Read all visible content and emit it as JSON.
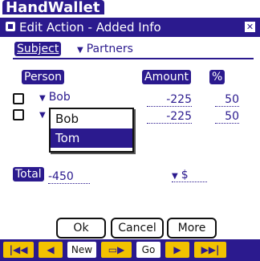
{
  "app": {
    "title": "HandWallet"
  },
  "dialog": {
    "title": "Edit Action - Added Info",
    "close_glyph": "✕"
  },
  "subject": {
    "label": "Subject",
    "value": "Partners"
  },
  "columns": {
    "person": "Person",
    "amount": "Amount",
    "percent": "%"
  },
  "rows": [
    {
      "person": "Bob",
      "amount": "-225",
      "percent": "50"
    },
    {
      "person": "",
      "amount": "-225",
      "percent": "50"
    }
  ],
  "popup": {
    "options": [
      "Bob",
      "Tom"
    ],
    "selected": "Tom"
  },
  "total": {
    "label": "Total",
    "amount": "-450",
    "currency": "$"
  },
  "buttons": {
    "ok": "Ok",
    "cancel": "Cancel",
    "more": "More"
  },
  "navbar": {
    "new_label": "New",
    "go_label": "Go"
  },
  "colors": {
    "accent": "#2b1a8e",
    "nav_button": "#f2c200"
  }
}
